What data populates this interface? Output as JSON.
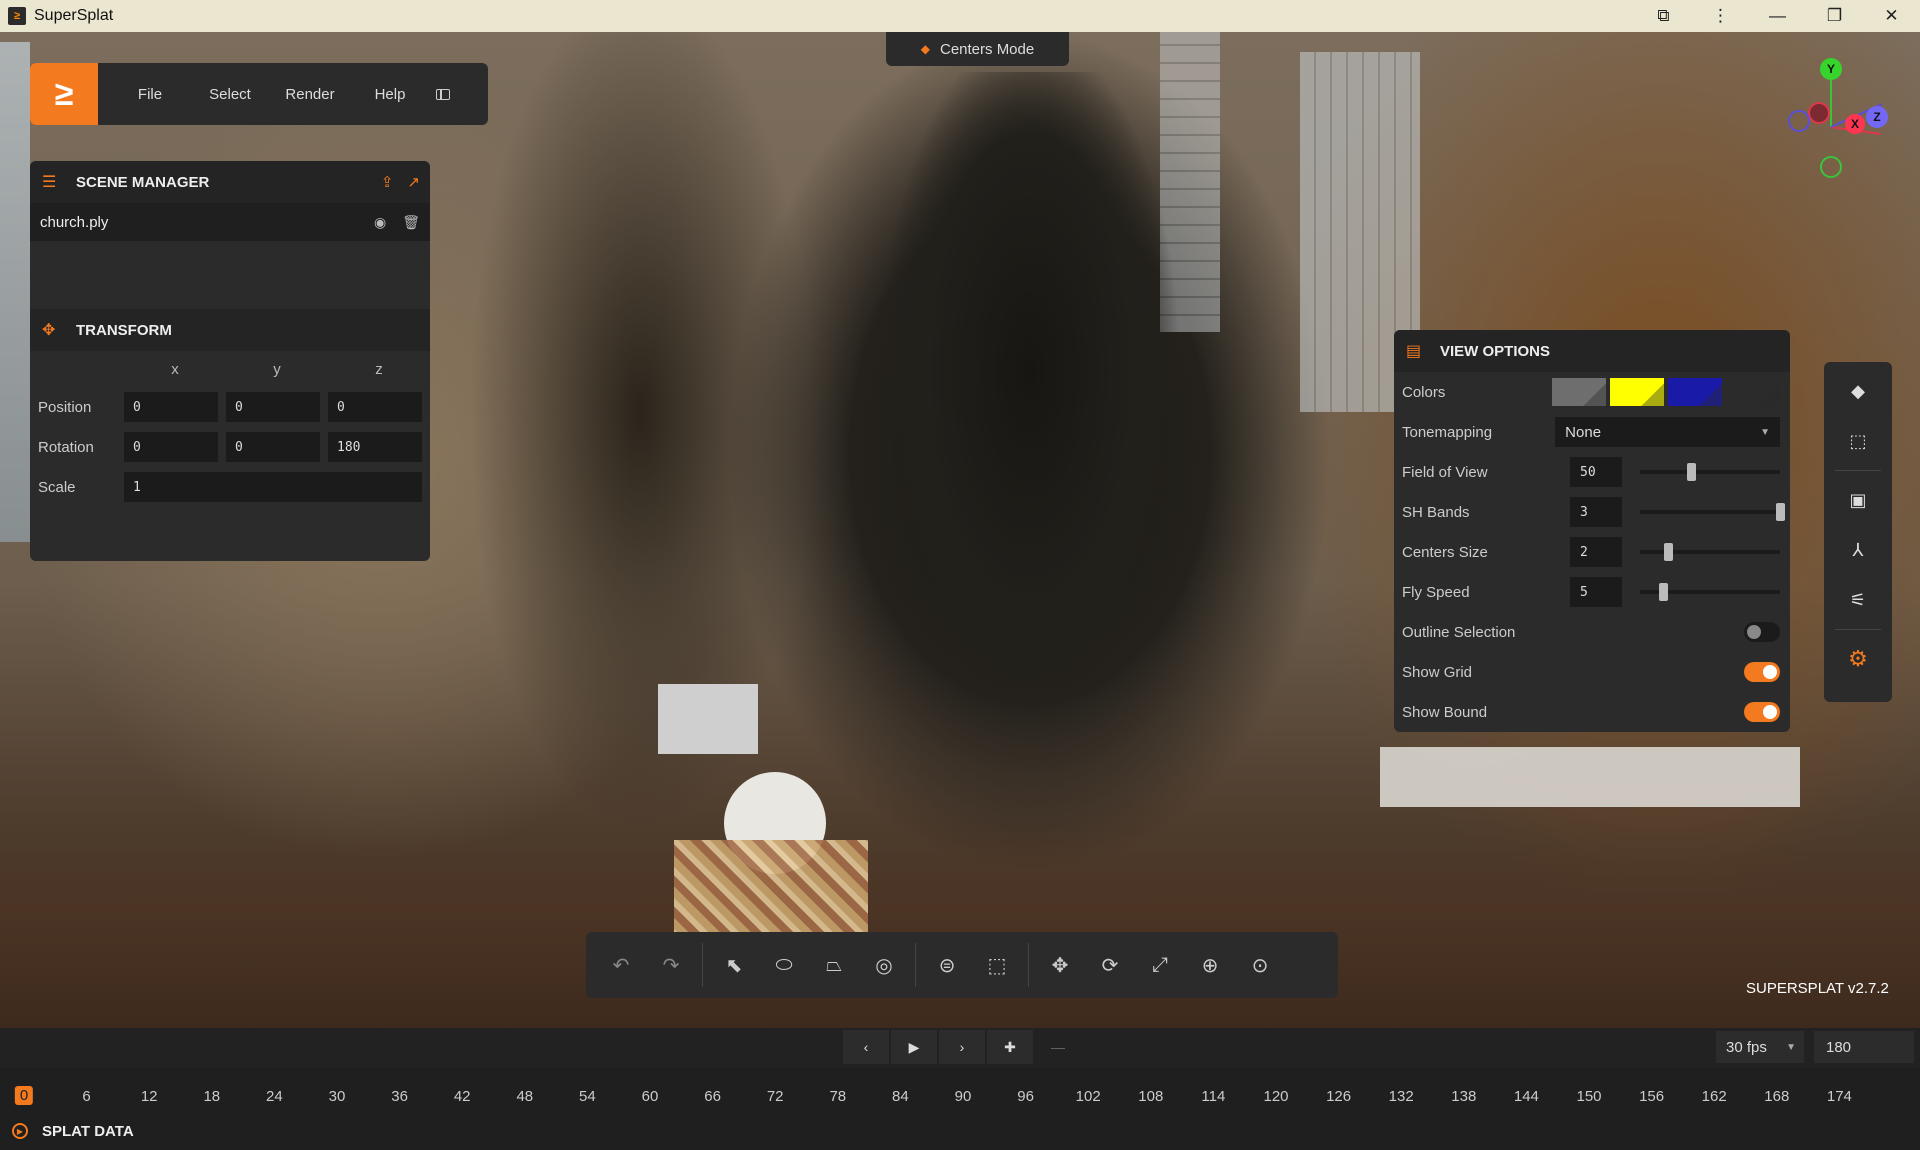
{
  "window": {
    "title": "SuperSplat"
  },
  "menu": {
    "items": [
      "File",
      "Select",
      "Render",
      "Help"
    ]
  },
  "mode": {
    "label": "Centers Mode"
  },
  "scene_manager": {
    "title": "SCENE MANAGER",
    "items": [
      {
        "name": "church.ply"
      }
    ]
  },
  "transform": {
    "title": "TRANSFORM",
    "axes": [
      "x",
      "y",
      "z"
    ],
    "position": {
      "label": "Position",
      "x": "0",
      "y": "0",
      "z": "0"
    },
    "rotation": {
      "label": "Rotation",
      "x": "0",
      "y": "0",
      "z": "180"
    },
    "scale": {
      "label": "Scale",
      "value": "1"
    }
  },
  "view_options": {
    "title": "VIEW OPTIONS",
    "colors": {
      "label": "Colors",
      "swatches": [
        "#6e6e6e",
        "#ffff00",
        "#1a1aa8",
        "#2b2b2b"
      ]
    },
    "tonemapping": {
      "label": "Tonemapping",
      "value": "None"
    },
    "field_of_view": {
      "label": "Field of View",
      "value": "50",
      "min": 10,
      "max": 120
    },
    "sh_bands": {
      "label": "SH Bands",
      "value": "3",
      "min": 0,
      "max": 3
    },
    "centers_size": {
      "label": "Centers Size",
      "value": "2",
      "min": 0,
      "max": 10
    },
    "fly_speed": {
      "label": "Fly Speed",
      "value": "5",
      "min": 0,
      "max": 30
    },
    "outline_selection": {
      "label": "Outline Selection",
      "on": false
    },
    "show_grid": {
      "label": "Show Grid",
      "on": true
    },
    "show_bound": {
      "label": "Show Bound",
      "on": true
    }
  },
  "gizmo": {
    "y": "Y",
    "x": "X",
    "z": "Z"
  },
  "version": "SUPERSPLAT v2.7.2",
  "timeline": {
    "fps": "30 fps",
    "frames": "180",
    "current_frame": "0",
    "ticks": [
      "6",
      "12",
      "18",
      "24",
      "30",
      "36",
      "42",
      "48",
      "54",
      "60",
      "66",
      "72",
      "78",
      "84",
      "90",
      "96",
      "102",
      "108",
      "114",
      "120",
      "126",
      "132",
      "138",
      "144",
      "150",
      "156",
      "162",
      "168",
      "174"
    ]
  },
  "splat_data": {
    "label": "SPLAT DATA"
  },
  "colors": {
    "accent": "#f47a1f",
    "panel": "#2b2b2b"
  }
}
